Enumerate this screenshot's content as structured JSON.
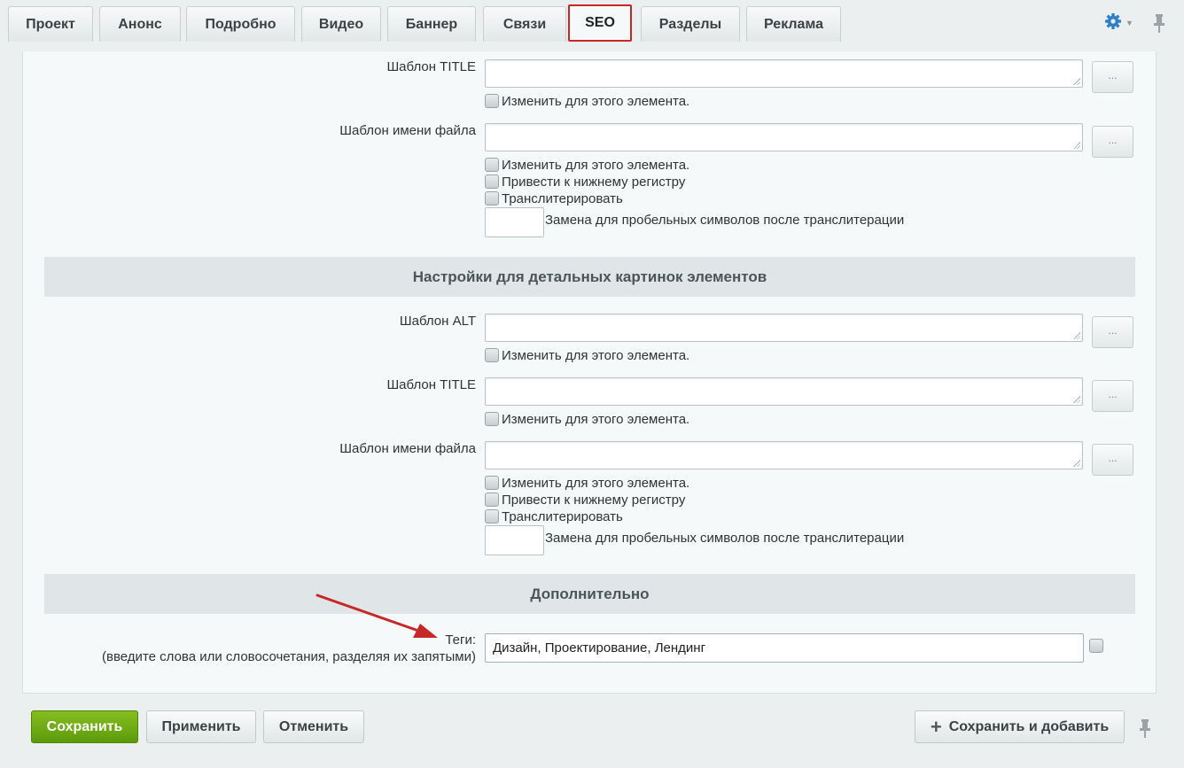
{
  "tabs": [
    "Проект",
    "Анонс",
    "Подробно",
    "Видео",
    "Баннер",
    "Связи",
    "SEO",
    "Разделы",
    "Реклама"
  ],
  "active_tab": "SEO",
  "accent_color": "#c62828",
  "section1": {
    "title_template_label": "Шаблон TITLE",
    "change_for_element": "Изменить для этого элемента.",
    "filename_template_label": "Шаблон имени файла",
    "lowercase": "Привести к нижнему регистру",
    "transliterate": "Транслитерировать",
    "space_replace": "Замена для пробельных символов после транслитерации"
  },
  "section2": {
    "heading": "Настройки для детальных картинок элементов",
    "alt_template_label": "Шаблон ALT",
    "title_template_label": "Шаблон TITLE",
    "filename_template_label": "Шаблон имени файла",
    "change_for_element": "Изменить для этого элемента.",
    "lowercase": "Привести к нижнему регистру",
    "transliterate": "Транслитерировать",
    "space_replace": "Замена для пробельных символов после транслитерации"
  },
  "extra": {
    "heading": "Дополнительно",
    "tags_label": "Теги:",
    "tags_hint": "(введите слова или словосочетания, разделяя их запятыми)",
    "tags_value": "Дизайн, Проектирование, Лендинг"
  },
  "dots_label": "...",
  "footer": {
    "save": "Сохранить",
    "apply": "Применить",
    "cancel": "Отменить",
    "save_and_add": "Сохранить и добавить"
  }
}
